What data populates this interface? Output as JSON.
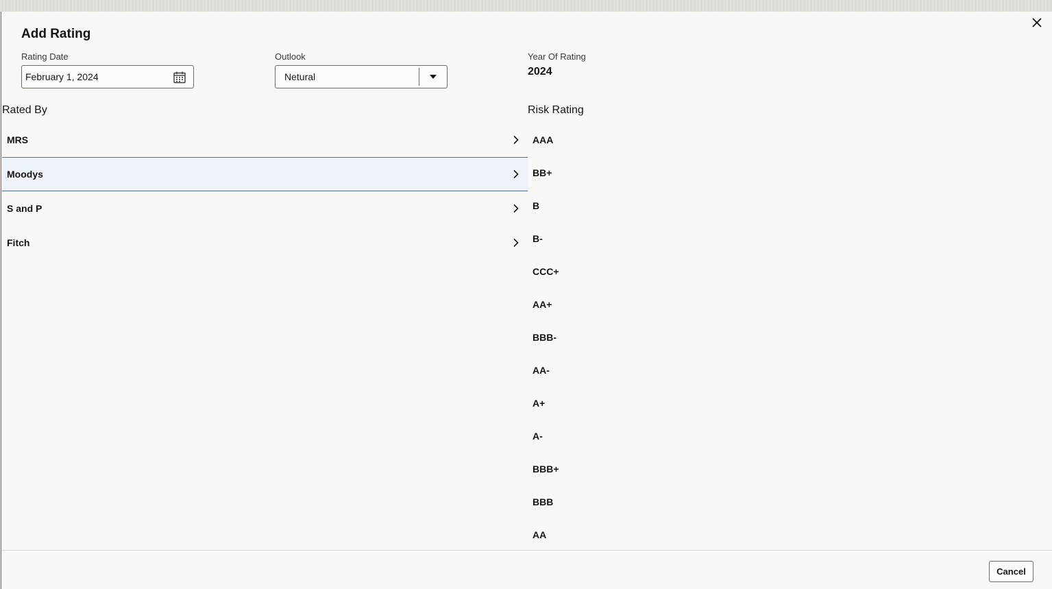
{
  "dialog": {
    "title": "Add Rating",
    "close_icon": "close-icon"
  },
  "form": {
    "rating_date": {
      "label": "Rating Date",
      "value": "February 1, 2024",
      "icon": "calendar-icon"
    },
    "outlook": {
      "label": "Outlook",
      "selected": "Netural",
      "icon": "caret-down-icon"
    },
    "year_of_rating": {
      "label": "Year Of Rating",
      "value": "2024"
    }
  },
  "rated_by": {
    "heading": "Rated By",
    "selected_index": 1,
    "items": [
      {
        "label": "MRS"
      },
      {
        "label": "Moodys"
      },
      {
        "label": "S and P"
      },
      {
        "label": "Fitch"
      }
    ],
    "item_icon": "chevron-right-icon"
  },
  "risk_rating": {
    "heading": "Risk Rating",
    "items": [
      "AAA",
      "BB+",
      "B",
      "B-",
      "CCC+",
      "AA+",
      "BBB-",
      "AA-",
      "A+",
      "A-",
      "BBB+",
      "BBB",
      "AA"
    ]
  },
  "footer": {
    "cancel_label": "Cancel"
  },
  "colors": {
    "selected_row_bg": "#eef2f9",
    "selected_row_border": "#5a6f96",
    "dialog_bg": "#f9f8f6",
    "text": "#161513"
  }
}
